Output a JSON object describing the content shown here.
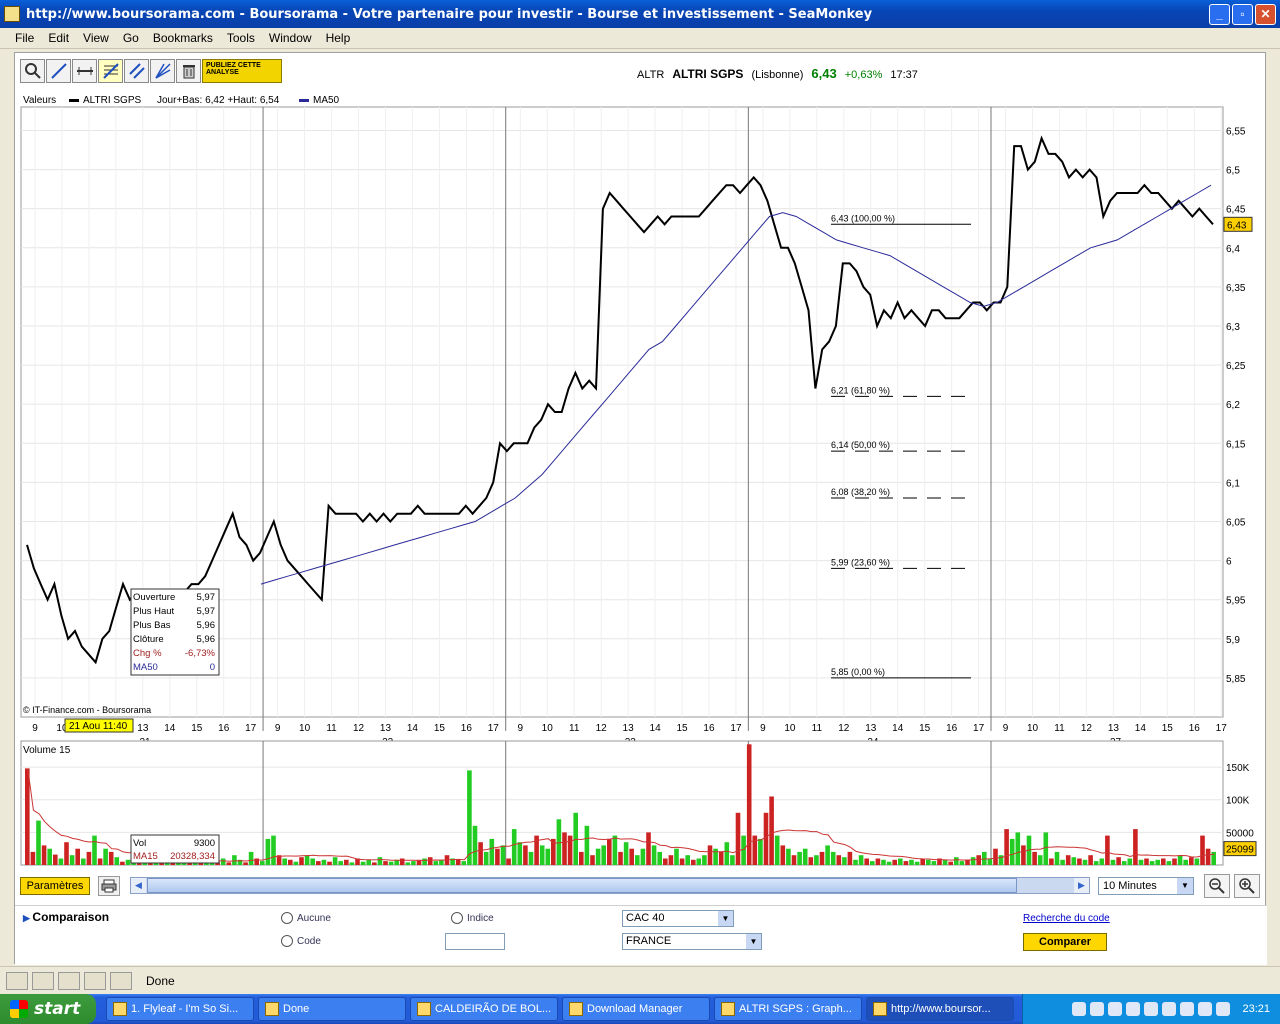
{
  "window": {
    "title": "http://www.boursorama.com - Boursorama - Votre partenaire pour investir - Bourse et investissement - SeaMonkey",
    "buttons": [
      "_",
      "▫",
      "✕"
    ]
  },
  "menu": [
    "File",
    "Edit",
    "View",
    "Go",
    "Bookmarks",
    "Tools",
    "Window",
    "Help"
  ],
  "toolbar": {
    "promo_label": "PUBLIEZ CETTE ANALYSE"
  },
  "quote": {
    "code": "ALTR",
    "name": "ALTRI SGPS",
    "market": "(Lisbonne)",
    "price": "6,43",
    "change": "+0,63%",
    "time": "17:37"
  },
  "legend": {
    "label": "Valeurs",
    "series_name": "ALTRI SGPS",
    "series_info": "Jour+Bas: 6,42 +Haut: 6,54",
    "ma_name": "MA50"
  },
  "colors": {
    "price": "#000000",
    "ma": "#2a2a9a",
    "vol_up": "#22cc22",
    "vol_down": "#cc2222",
    "ma15": "#cc3333",
    "cursor_label": "#ffff00",
    "last_badge": "#ffd000"
  },
  "chart_data": {
    "type": "line",
    "ylim": [
      5.8,
      6.58
    ],
    "y_ticks": [
      "6,55",
      "6,5",
      "6,45",
      "6,4",
      "6,35",
      "6,3",
      "6,25",
      "6,2",
      "6,15",
      "6,1",
      "6,05",
      "6",
      "5,95",
      "5,9",
      "5,85"
    ],
    "y_tick_values": [
      6.55,
      6.5,
      6.45,
      6.4,
      6.35,
      6.3,
      6.25,
      6.2,
      6.15,
      6.1,
      6.05,
      6.0,
      5.95,
      5.9,
      5.85
    ],
    "last_value_label": "6,43",
    "x_ticks": [
      "9",
      "10",
      "11",
      "12",
      "13",
      "14",
      "15",
      "16",
      "17",
      "9",
      "10",
      "11",
      "12",
      "13",
      "14",
      "15",
      "16",
      "17",
      "9",
      "10",
      "11",
      "12",
      "13",
      "14",
      "15",
      "16",
      "17",
      "9",
      "10",
      "11",
      "12",
      "13",
      "14",
      "15",
      "16",
      "17",
      "9",
      "10",
      "11",
      "12",
      "13",
      "14",
      "15",
      "16",
      "17"
    ],
    "x_dates": [
      "21",
      "22",
      "23",
      "24",
      "27"
    ],
    "cursor_label": "21 Aou 11:40",
    "copyright": "© IT-Finance.com - Boursorama",
    "price": [
      6.02,
      5.99,
      5.97,
      5.95,
      5.97,
      5.93,
      5.9,
      5.91,
      5.89,
      5.88,
      5.87,
      5.9,
      5.91,
      5.94,
      5.97,
      5.95,
      5.96,
      5.94,
      5.93,
      5.94,
      5.95,
      5.94,
      5.95,
      5.96,
      5.97,
      5.97,
      5.98,
      6.0,
      6.02,
      6.04,
      6.06,
      6.03,
      6.02,
      6.0,
      6.01,
      6.03,
      6.05,
      6.02,
      6.0,
      5.99,
      5.98,
      5.97,
      5.96,
      5.95,
      6.07,
      6.06,
      6.06,
      6.06,
      6.06,
      6.05,
      6.06,
      6.05,
      6.06,
      6.05,
      6.06,
      6.06,
      6.06,
      6.07,
      6.06,
      6.06,
      6.06,
      6.06,
      6.06,
      6.06,
      6.07,
      6.06,
      6.07,
      6.08,
      6.1,
      6.15,
      6.14,
      6.15,
      6.15,
      6.15,
      6.17,
      6.18,
      6.2,
      6.19,
      6.19,
      6.22,
      6.24,
      6.22,
      6.23,
      6.22,
      6.45,
      6.47,
      6.46,
      6.45,
      6.44,
      6.43,
      6.42,
      6.43,
      6.44,
      6.43,
      6.44,
      6.44,
      6.44,
      6.44,
      6.44,
      6.45,
      6.46,
      6.47,
      6.48,
      6.48,
      6.47,
      6.48,
      6.49,
      6.48,
      6.46,
      6.43,
      6.4,
      6.4,
      6.38,
      6.35,
      6.32,
      6.22,
      6.27,
      6.28,
      6.3,
      6.38,
      6.38,
      6.37,
      6.35,
      6.34,
      6.3,
      6.32,
      6.31,
      6.33,
      6.31,
      6.32,
      6.31,
      6.3,
      6.32,
      6.32,
      6.31,
      6.31,
      6.31,
      6.32,
      6.33,
      6.33,
      6.32,
      6.33,
      6.33,
      6.35,
      6.53,
      6.53,
      6.5,
      6.51,
      6.54,
      6.52,
      6.52,
      6.51,
      6.49,
      6.5,
      6.49,
      6.5,
      6.49,
      6.44,
      6.46,
      6.47,
      6.47,
      6.47,
      6.47,
      6.48,
      6.47,
      6.47,
      6.46,
      6.45,
      6.46,
      6.45,
      6.44,
      6.45,
      6.44,
      6.43
    ],
    "ma50": [
      5.97,
      5.975,
      5.98,
      5.985,
      5.99,
      5.995,
      6.0,
      6.005,
      6.01,
      6.015,
      6.02,
      6.025,
      6.03,
      6.035,
      6.04,
      6.045,
      6.05,
      6.06,
      6.07,
      6.08,
      6.095,
      6.11,
      6.13,
      6.15,
      6.17,
      6.19,
      6.21,
      6.23,
      6.25,
      6.27,
      6.28,
      6.3,
      6.32,
      6.34,
      6.36,
      6.38,
      6.4,
      6.42,
      6.44,
      6.445,
      6.44,
      6.43,
      6.42,
      6.41,
      6.405,
      6.4,
      6.395,
      6.39,
      6.38,
      6.37,
      6.36,
      6.35,
      6.34,
      6.33,
      6.325,
      6.33,
      6.34,
      6.35,
      6.36,
      6.37,
      6.38,
      6.39,
      6.4,
      6.405,
      6.41,
      6.42,
      6.43,
      6.44,
      6.45,
      6.46,
      6.47,
      6.48
    ],
    "fibonacci": [
      {
        "label": "6,43 (100,00 %)",
        "value": 6.43
      },
      {
        "label": "6,21 (61,80 %)",
        "value": 6.21
      },
      {
        "label": "6,14 (50,00 %)",
        "value": 6.14
      },
      {
        "label": "6,08 (38,20 %)",
        "value": 6.08
      },
      {
        "label": "5,99 (23,60 %)",
        "value": 5.99
      },
      {
        "label": "5,85 (0,00 %)",
        "value": 5.85
      }
    ],
    "tooltip": [
      {
        "k": "Ouverture",
        "v": "5,97"
      },
      {
        "k": "Plus Haut",
        "v": "5,97"
      },
      {
        "k": "Plus Bas",
        "v": "5,96"
      },
      {
        "k": "Clôture",
        "v": "5,96"
      },
      {
        "k": "Chg %",
        "v": "-6,73%"
      },
      {
        "k": "MA50",
        "v": "0"
      }
    ],
    "volume": {
      "title": "Volume 15",
      "ylim": [
        0,
        190000
      ],
      "y_ticks": [
        "150K",
        "100K",
        "50000"
      ],
      "y_tick_values": [
        150000,
        100000,
        50000
      ],
      "last_value_label": "25099",
      "tooltip": [
        {
          "k": "Vol",
          "v": "9300"
        },
        {
          "k": "MA15",
          "v": "20328,334"
        }
      ],
      "bars": [
        148000,
        20000,
        68000,
        30000,
        25000,
        16000,
        10000,
        35000,
        15000,
        25000,
        10000,
        20000,
        45000,
        10000,
        25000,
        20000,
        12000,
        5000,
        8000,
        30000,
        15000,
        10000,
        8000,
        5000,
        9000,
        4000,
        6000,
        3000,
        8000,
        4000,
        5000,
        3000,
        6000,
        8000,
        5000,
        10000,
        4000,
        15000,
        8000,
        4000,
        20000,
        10000,
        6000,
        40000,
        45000,
        15000,
        10000,
        8000,
        5000,
        12000,
        15000,
        10000,
        6000,
        8000,
        5000,
        12000,
        6000,
        8000,
        4000,
        10000,
        5000,
        8000,
        4000,
        12000,
        6000,
        5000,
        8000,
        10000,
        4000,
        6000,
        8000,
        10000,
        12000,
        6000,
        8000,
        15000,
        10000,
        8000,
        6000,
        145000,
        60000,
        35000,
        20000,
        40000,
        25000,
        30000,
        10000,
        55000,
        35000,
        30000,
        20000,
        45000,
        30000,
        25000,
        40000,
        70000,
        50000,
        45000,
        80000,
        20000,
        60000,
        15000,
        25000,
        30000,
        40000,
        45000,
        20000,
        35000,
        25000,
        15000,
        25000,
        50000,
        30000,
        20000,
        10000,
        15000,
        25000,
        10000,
        15000,
        8000,
        10000,
        15000,
        30000,
        25000,
        20000,
        35000,
        15000,
        80000,
        45000,
        185000,
        45000,
        40000,
        80000,
        105000,
        45000,
        30000,
        25000,
        15000,
        20000,
        25000,
        12000,
        15000,
        20000,
        30000,
        20000,
        15000,
        12000,
        20000,
        8000,
        15000,
        10000,
        6000,
        10000,
        8000,
        5000,
        8000,
        10000,
        6000,
        8000,
        5000,
        10000,
        8000,
        6000,
        10000,
        8000,
        5000,
        12000,
        6000,
        8000,
        12000,
        15000,
        20000,
        10000,
        25000,
        15000,
        55000,
        40000,
        50000,
        30000,
        45000,
        20000,
        15000,
        50000,
        10000,
        20000,
        8000,
        15000,
        12000,
        10000,
        8000,
        15000,
        6000,
        10000,
        45000,
        8000,
        12000,
        6000,
        10000,
        55000,
        8000,
        10000,
        6000,
        8000,
        10000,
        6000,
        10000,
        15000,
        8000,
        12000,
        10000,
        45000,
        25000,
        20000
      ],
      "down": [
        1,
        1,
        0,
        1,
        0,
        1,
        0,
        1,
        0,
        1,
        0,
        1,
        0,
        1,
        0,
        1,
        0,
        1,
        0,
        0,
        1,
        0,
        1,
        0,
        1,
        0,
        1,
        0,
        0,
        1,
        0,
        1,
        0,
        0,
        1,
        0,
        1,
        0,
        0,
        1,
        0,
        1,
        0,
        0,
        0,
        1,
        0,
        1,
        0,
        1,
        0,
        0,
        1,
        0,
        1,
        0,
        0,
        1,
        0,
        1,
        0,
        0,
        1,
        0,
        1,
        0,
        0,
        1,
        0,
        0,
        1,
        0,
        1,
        0,
        0,
        1,
        0,
        1,
        0,
        0,
        0,
        1,
        0,
        0,
        1,
        0,
        1,
        0,
        0,
        1,
        0,
        1,
        0,
        0,
        1,
        0,
        1,
        1,
        0,
        1,
        0,
        1,
        0,
        0,
        1,
        0,
        1,
        0,
        1,
        0,
        0,
        1,
        0,
        0,
        1,
        1,
        0,
        1,
        0,
        1,
        0,
        0,
        1,
        0,
        1,
        0,
        0,
        1,
        0,
        1,
        1,
        0,
        1,
        1,
        0,
        1,
        0,
        1,
        0,
        0,
        1,
        0,
        1,
        0,
        0,
        1,
        0,
        1,
        0,
        0,
        1,
        0,
        1,
        0,
        0,
        1,
        0,
        1,
        0,
        0,
        1,
        0,
        0,
        1,
        0,
        1,
        0,
        0,
        1,
        0,
        1,
        0,
        0,
        1,
        0,
        1,
        0,
        0,
        1,
        0,
        1,
        0,
        0,
        1,
        0,
        0,
        1,
        0,
        1,
        0,
        1,
        0,
        0,
        1,
        0,
        1,
        0,
        0,
        1,
        0,
        1,
        0,
        0,
        1,
        0,
        1,
        0,
        0,
        1,
        0,
        1,
        1,
        0
      ]
    }
  },
  "controls": {
    "params_label": "Paramètres",
    "interval": "10 Minutes"
  },
  "compare": {
    "label": "Comparaison",
    "opt_none": "Aucune",
    "opt_index": "Indice",
    "opt_code": "Code",
    "index_value": "CAC 40",
    "country_value": "FRANCE",
    "search_link": "Recherche du code",
    "compare_button": "Comparer"
  },
  "status": {
    "text": "Done"
  },
  "taskbar": {
    "start_label": "start",
    "tasks": [
      "1. Flyleaf - I'm So Si...",
      "Done",
      "CALDEIRÃO DE BOL...",
      "Download Manager",
      "ALTRI SGPS : Graph...",
      "http://www.boursor..."
    ],
    "clock": "23:21"
  }
}
